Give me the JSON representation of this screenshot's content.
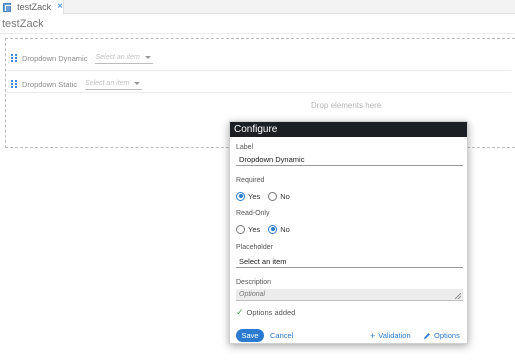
{
  "tab": {
    "label": "testZack",
    "close_glyph": "×"
  },
  "page": {
    "title": "testZack"
  },
  "form": {
    "rows": [
      {
        "label": "Dropdown Dynamic",
        "placeholder": "Select an item"
      },
      {
        "label": "Dropdown Static",
        "placeholder": "Select an item"
      }
    ],
    "drop_text": "Drop elements here"
  },
  "dialog": {
    "title": "Configure",
    "label_field": {
      "label": "Label",
      "value": "Dropdown Dynamic"
    },
    "required": {
      "label": "Required",
      "yes": "Yes",
      "no": "No",
      "selected": "Yes"
    },
    "readonly": {
      "label": "Read-Only",
      "yes": "Yes",
      "no": "No",
      "selected": "No"
    },
    "placeholder_field": {
      "label": "Placeholder",
      "value": "Select an item"
    },
    "description_field": {
      "label": "Description",
      "placeholder": "Optional"
    },
    "status": "Options added",
    "buttons": {
      "save": "Save",
      "cancel": "Cancel",
      "validation": "Validation",
      "options": "Options"
    }
  },
  "colors": {
    "accent": "#2a7bd0",
    "header_bg": "#1c1f24",
    "success": "#43a047"
  },
  "icons": [
    "form-icon",
    "close-icon",
    "drag-handle-icon",
    "caret-down-icon",
    "check-icon",
    "plus-icon",
    "pencil-icon",
    "resize-grip-icon"
  ]
}
